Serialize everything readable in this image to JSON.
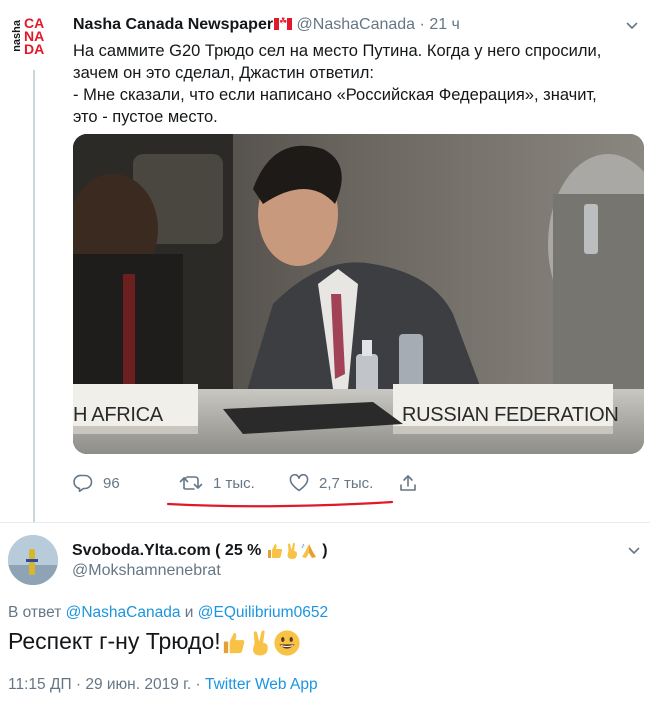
{
  "tweet": {
    "author_name": "Nasha Canada Newspaper",
    "author_handle": "@NashaCanada",
    "separator": "·",
    "time": "21 ч",
    "avatar_logo_small": "nasha",
    "avatar_logo_big": "CANADA",
    "text_lines": [
      "На саммите G20 Трюдо сел на место Путина. Когда у него спросили,",
      "зачем он это сделал, Джастин ответил:",
      "- Мне сказали, что если написано «Российская Федерация», значит,",
      "это - пустое место."
    ],
    "media": {
      "placard_left": "H AFRICA",
      "placard_right": "RUSSIAN FEDERATION"
    },
    "actions": {
      "replies": "96",
      "retweets": "1 тыс.",
      "likes": "2,7 тыс."
    },
    "annotation_color": "#e0192a"
  },
  "reply": {
    "author_name": "Svoboda.Ylta.com ( 25 %",
    "author_name_suffix": ")",
    "author_handle": "@Mokshamnenebrat",
    "reply_prefix": "В ответ",
    "reply_mention_1": "@NashaCanada",
    "reply_conjunction": "и",
    "reply_mention_2": "@EQuilibrium0652",
    "text": "Респект г-ну Трюдо!",
    "timestamp": "11:15 ДП · 29 июн. 2019 г. ·",
    "client": "Twitter Web App"
  },
  "colors": {
    "text": "#14171a",
    "secondary": "#657786",
    "link": "#1b95e0",
    "divider": "#e6ecf0"
  },
  "icons": [
    "reply-icon",
    "retweet-icon",
    "like-icon",
    "share-icon",
    "chevron-down-icon",
    "canada-flag-icon",
    "thumbs-up-emoji",
    "victory-hand-emoji",
    "folded-hands-emoji",
    "grinning-face-emoji"
  ]
}
